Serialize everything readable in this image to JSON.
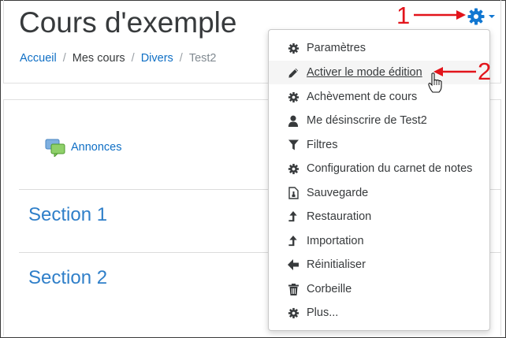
{
  "header": {
    "title": "Cours d'exemple",
    "breadcrumb": [
      "Accueil",
      "Mes cours",
      "Divers",
      "Test2"
    ]
  },
  "markers": {
    "one": "1",
    "two": "2"
  },
  "content": {
    "announcements_label": "Annonces",
    "sections": [
      "Section 1",
      "Section 2"
    ]
  },
  "menu": {
    "items": [
      {
        "label": "Paramètres",
        "icon": "gear-icon"
      },
      {
        "label": "Activer le mode édition",
        "icon": "pencil-icon"
      },
      {
        "label": "Achèvement de cours",
        "icon": "gear-icon"
      },
      {
        "label": "Me désinscrire de Test2",
        "icon": "user-icon"
      },
      {
        "label": "Filtres",
        "icon": "filter-icon"
      },
      {
        "label": "Configuration du carnet de notes",
        "icon": "gear-icon"
      },
      {
        "label": "Sauvegarde",
        "icon": "backup-file-icon"
      },
      {
        "label": "Restauration",
        "icon": "upload-arrow-icon"
      },
      {
        "label": "Importation",
        "icon": "upload-arrow-icon"
      },
      {
        "label": "Réinitialiser",
        "icon": "arrow-left-icon"
      },
      {
        "label": "Corbeille",
        "icon": "trash-icon"
      },
      {
        "label": "Plus...",
        "icon": "gear-icon"
      }
    ]
  },
  "colors": {
    "link": "#0f6fc5",
    "marker": "#e2141b",
    "gear": "#1177d1"
  }
}
